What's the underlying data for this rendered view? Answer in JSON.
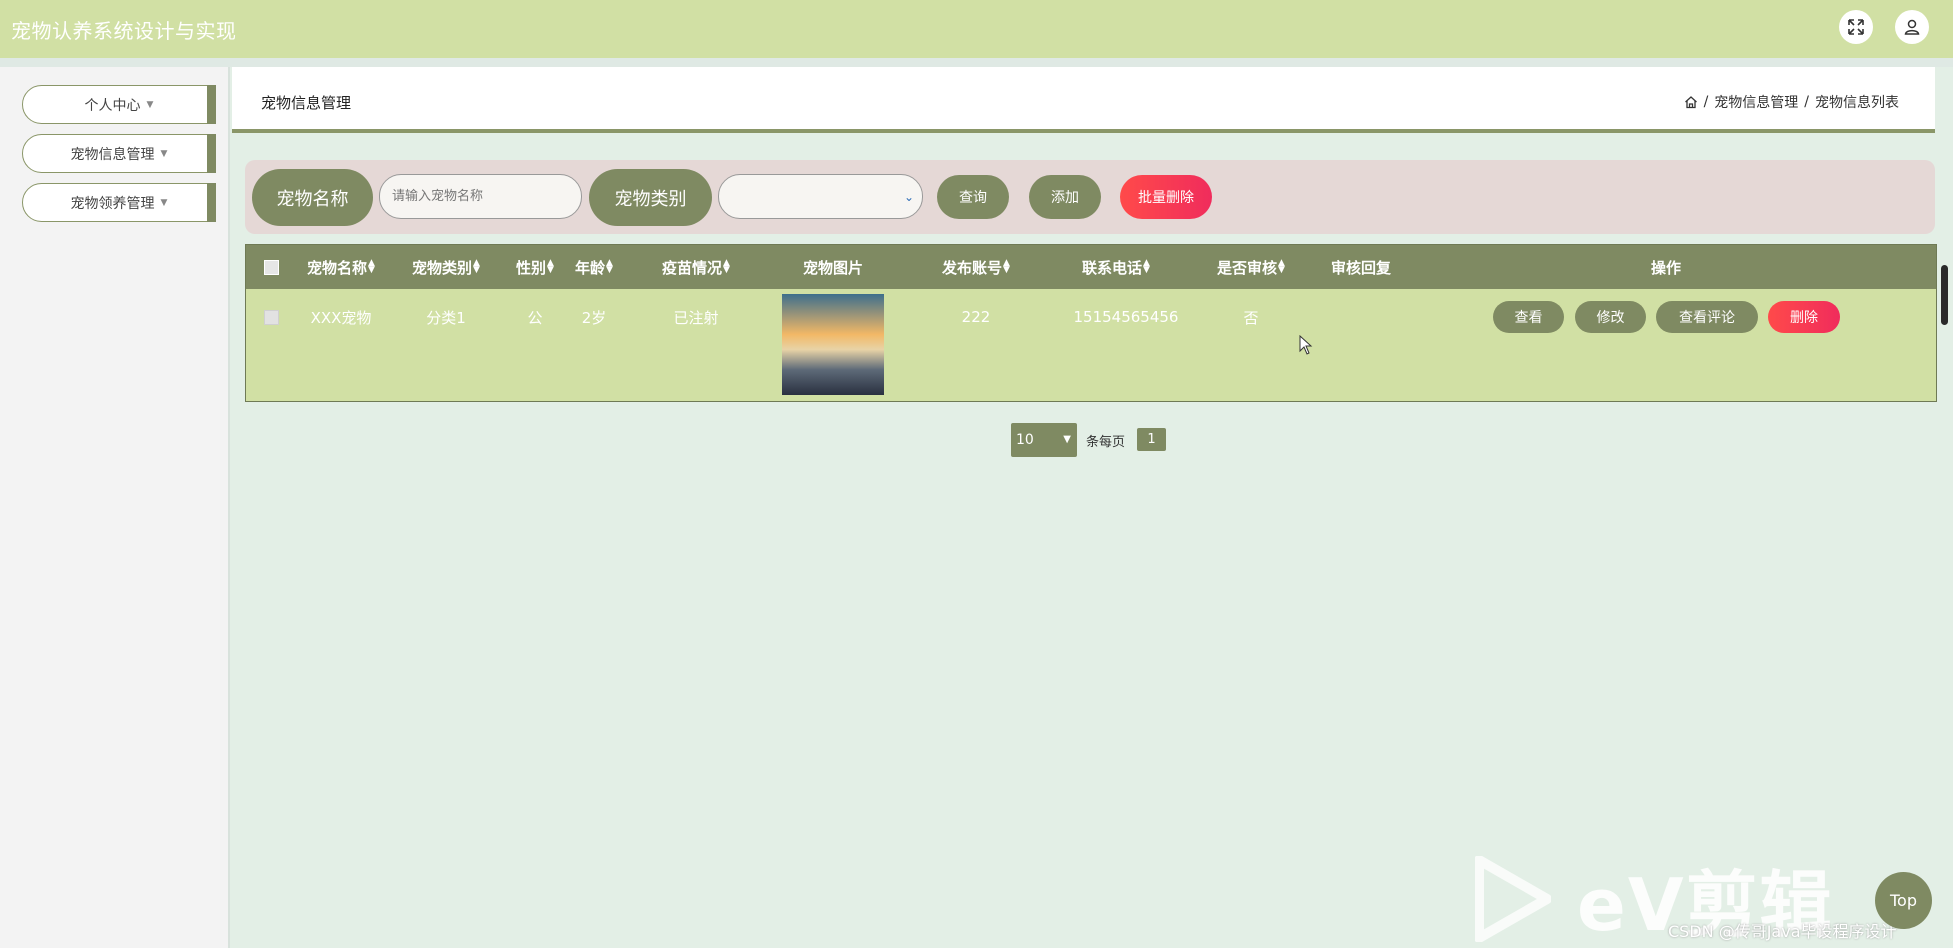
{
  "app_title": "宠物认养系统设计与实现",
  "top_icons": [
    "expand-icon",
    "user-icon"
  ],
  "sidebar": {
    "items": [
      {
        "label": "个人中心"
      },
      {
        "label": "宠物信息管理"
      },
      {
        "label": "宠物领养管理"
      }
    ]
  },
  "header": {
    "page_title": "宠物信息管理",
    "breadcrumb": [
      "宠物信息管理",
      "宠物信息列表"
    ]
  },
  "search": {
    "name_label": "宠物名称",
    "name_placeholder": "请输入宠物名称",
    "category_label": "宠物类别",
    "category_value": "",
    "query_btn": "查询",
    "add_btn": "添加",
    "batch_delete_btn": "批量删除"
  },
  "table": {
    "columns": [
      "宠物名称",
      "宠物类别",
      "性别",
      "年龄",
      "疫苗情况",
      "宠物图片",
      "发布账号",
      "联系电话",
      "是否审核",
      "审核回复",
      "操作"
    ],
    "rows": [
      {
        "name": "XXX宠物",
        "category": "分类1",
        "gender": "公",
        "age": "2岁",
        "vaccine": "已注射",
        "account": "222",
        "phone": "15154565456",
        "reviewed": "否",
        "reply": ""
      }
    ],
    "actions": {
      "view": "查看",
      "edit": "修改",
      "comments": "查看评论",
      "delete": "删除"
    }
  },
  "pagination": {
    "page_size": "10",
    "per_page_label": "条每页",
    "current_page": "1"
  },
  "top_button": "Top",
  "watermark": {
    "ev_text": "eV剪辑",
    "csdn_text": "CSDN @传哥Java毕设程序设计"
  },
  "colors": {
    "topbar": "#d1e0a4",
    "accent": "#7f8a62",
    "danger": "#f0345a",
    "search_bg": "#e5d8d6",
    "page_bg": "#e3efe6"
  }
}
